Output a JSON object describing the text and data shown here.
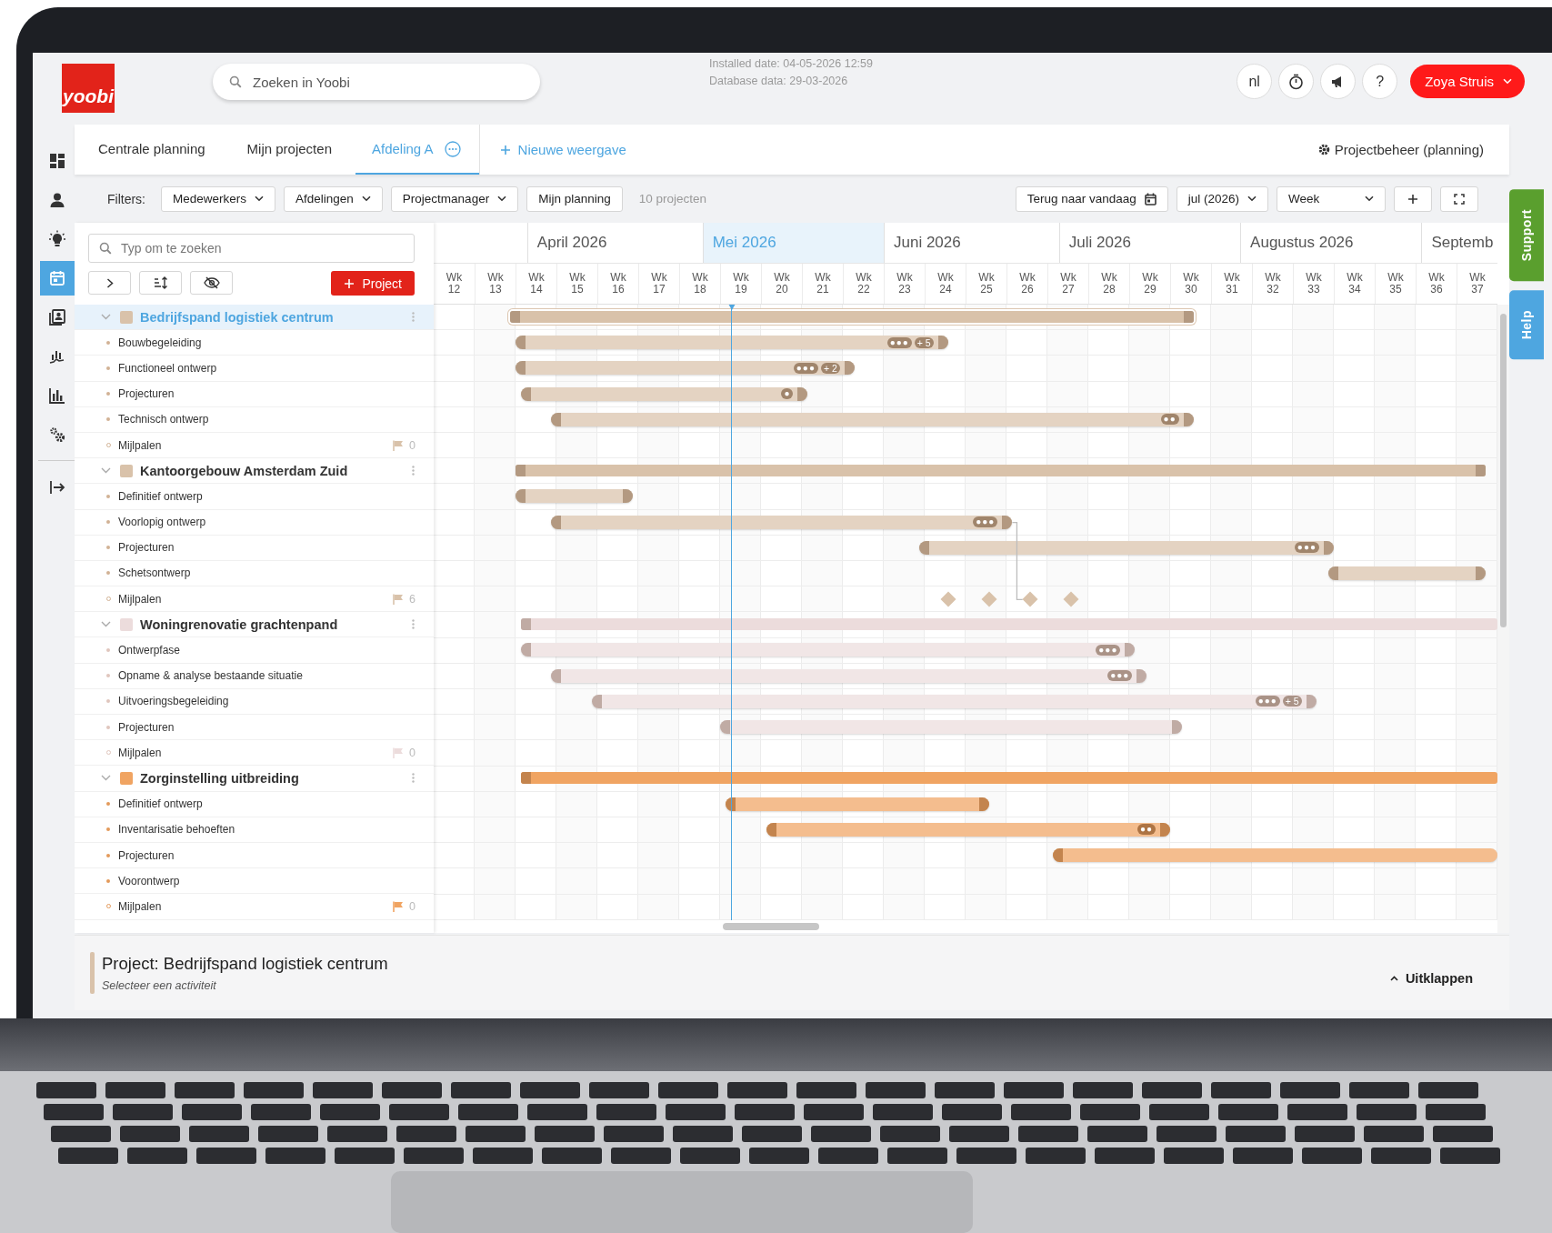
{
  "header": {
    "logo": "yoobi",
    "search": {
      "placeholder": "Zoeken in Yoobi"
    },
    "info": [
      "Installed date: 04-05-2026 12:59",
      "Database data: 29-03-2026"
    ],
    "actions": [
      {
        "kind": "text",
        "label": "nl"
      },
      {
        "kind": "timer"
      },
      {
        "kind": "megaphone"
      },
      {
        "kind": "text",
        "label": "?"
      }
    ],
    "user": {
      "name": "Zoya Struis"
    }
  },
  "sidebar": {
    "items": [
      {
        "kind": "dashboard",
        "selected": false
      },
      {
        "kind": "person",
        "selected": false
      },
      {
        "kind": "bulb",
        "selected": false
      },
      {
        "kind": "calendar",
        "selected": true
      },
      {
        "kind": "contacts",
        "selected": false
      },
      {
        "kind": "growth",
        "selected": false
      },
      {
        "kind": "bars",
        "selected": false
      },
      {
        "kind": "gears",
        "selected": false
      }
    ],
    "bottom_items": [
      {
        "kind": "logout",
        "selected": false
      }
    ]
  },
  "tabs": [
    {
      "label": "Centrale planning",
      "selected": false,
      "menu": false
    },
    {
      "label": "Mijn projecten",
      "selected": false,
      "menu": false
    },
    {
      "label": "Afdeling A",
      "selected": true,
      "menu": true
    }
  ],
  "new_view": {
    "label": "Nieuwe weergave"
  },
  "settings_link": {
    "label": "Projectbeheer (planning)"
  },
  "filters": {
    "label": "Filters:",
    "items": [
      {
        "kind": "dropdown",
        "label": "Medewerkers"
      },
      {
        "kind": "dropdown",
        "label": "Afdelingen"
      },
      {
        "kind": "dropdown",
        "label": "Projectmanager"
      },
      {
        "kind": "button",
        "label": "Mijn planning"
      }
    ],
    "count": "10 projecten"
  },
  "view_controls": {
    "today": "Terug naar vandaag",
    "period": "jul (2026)",
    "scale": "Week"
  },
  "list": {
    "search": {
      "placeholder": "Typ om te zoeken"
    },
    "add_button": "Project"
  },
  "timeline": {
    "months": [
      {
        "label": "April 2026",
        "current": false
      },
      {
        "label": "Mei 2026",
        "current": true
      },
      {
        "label": "Juni 2026",
        "current": false
      },
      {
        "label": "Juli 2026",
        "current": false
      },
      {
        "label": "Augustus 2026",
        "current": false
      },
      {
        "label": "Septemb",
        "current": false
      }
    ],
    "weeks": [
      {
        "label": "Wk",
        "number": "12"
      },
      {
        "label": "Wk",
        "number": "13"
      },
      {
        "label": "Wk",
        "number": "14"
      },
      {
        "label": "Wk",
        "number": "15"
      },
      {
        "label": "Wk",
        "number": "16"
      },
      {
        "label": "Wk",
        "number": "17"
      },
      {
        "label": "Wk",
        "number": "18"
      },
      {
        "label": "Wk",
        "number": "19"
      },
      {
        "label": "Wk",
        "number": "20"
      },
      {
        "label": "Wk",
        "number": "21"
      },
      {
        "label": "Wk",
        "number": "22"
      },
      {
        "label": "Wk",
        "number": "23"
      },
      {
        "label": "Wk",
        "number": "24"
      },
      {
        "label": "Wk",
        "number": "25"
      },
      {
        "label": "Wk",
        "number": "26"
      },
      {
        "label": "Wk",
        "number": "27"
      },
      {
        "label": "Wk",
        "number": "28"
      },
      {
        "label": "Wk",
        "number": "29"
      },
      {
        "label": "Wk",
        "number": "30"
      },
      {
        "label": "Wk",
        "number": "31"
      },
      {
        "label": "Wk",
        "number": "32"
      },
      {
        "label": "Wk",
        "number": "33"
      },
      {
        "label": "Wk",
        "number": "34"
      },
      {
        "label": "Wk",
        "number": "35"
      },
      {
        "label": "Wk",
        "number": "36"
      },
      {
        "label": "Wk",
        "number": "37"
      }
    ]
  },
  "projects": [
    {
      "name": "Bedrijfspand logistiek centrum",
      "color": "#d9c2aa",
      "selected": true,
      "expanded": true,
      "activities": [
        {
          "name": "Bouwbegeleiding",
          "avatars": "●●●",
          "more": "+ 5"
        },
        {
          "name": "Functioneel ontwerp",
          "avatars": "●●●",
          "more": "+ 2"
        },
        {
          "name": "Projecturen",
          "avatars": "●"
        },
        {
          "name": "Technisch ontwerp",
          "avatars": "●●"
        }
      ],
      "milestones": {
        "label": "Mijlpalen",
        "count": "0"
      }
    },
    {
      "name": "Kantoorgebouw Amsterdam Zuid",
      "color": "#d9c2aa",
      "selected": false,
      "expanded": true,
      "activities": [
        {
          "name": "Definitief ontwerp"
        },
        {
          "name": "Voorlopig ontwerp",
          "avatars": "●●●"
        },
        {
          "name": "Projecturen",
          "avatars": "●●●"
        },
        {
          "name": "Schetsontwerp"
        }
      ],
      "milestones": {
        "label": "Mijlpalen",
        "count": "6"
      }
    },
    {
      "name": "Woningrenovatie grachtenpand",
      "color": "#ecdcdc",
      "selected": false,
      "expanded": true,
      "activities": [
        {
          "name": "Ontwerpfase",
          "avatars": "●●●"
        },
        {
          "name": "Opname & analyse bestaande situatie",
          "avatars": "●●●"
        },
        {
          "name": "Uitvoeringsbegeleiding",
          "avatars": "●●●",
          "more": "+ 5"
        },
        {
          "name": "Projecturen"
        }
      ],
      "milestones": {
        "label": "Mijlpalen",
        "count": "0"
      }
    },
    {
      "name": "Zorginstelling uitbreiding",
      "color": "#f0a462",
      "selected": false,
      "expanded": true,
      "activities": [
        {
          "name": "Definitief ontwerp"
        },
        {
          "name": "Inventarisatie behoeften",
          "avatars": "●●"
        },
        {
          "name": "Projecturen"
        },
        {
          "name": "Voorontwerp"
        }
      ],
      "milestones": {
        "label": "Mijlpalen",
        "count": "0"
      }
    }
  ],
  "detail": {
    "title": "Project: Bedrijfspand logistiek centrum",
    "subtitle": "Selecteer een activiteit",
    "expand": "Uitklappen"
  },
  "side_tabs": [
    {
      "label": "Support",
      "color": "#5a9f2e"
    },
    {
      "label": "Help",
      "color": "#4ea6e0"
    }
  ]
}
